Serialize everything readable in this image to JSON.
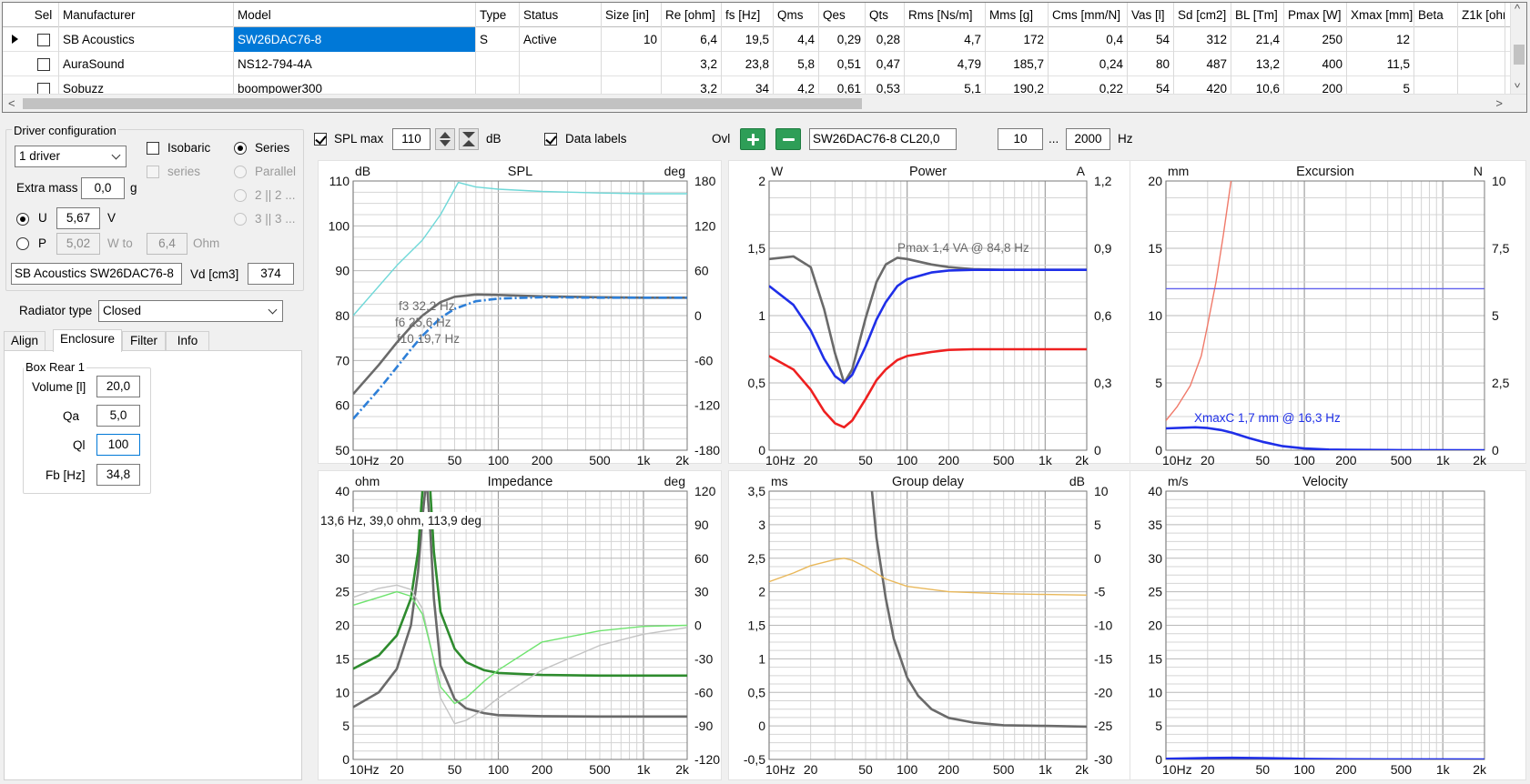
{
  "grid": {
    "columns": [
      "Sel",
      "Manufacturer",
      "Model",
      "Type",
      "Status",
      "Size [in]",
      "Re [ohm]",
      "fs [Hz]",
      "Qms",
      "Qes",
      "Qts",
      "Rms [Ns/m]",
      "Mms [g]",
      "Cms [mm/N]",
      "Vas [l]",
      "Sd [cm2]",
      "BL [Tm]",
      "Pmax [W]",
      "Xmax [mm]",
      "Beta",
      "Z1k [ohm"
    ],
    "rows": [
      {
        "sel": false,
        "cells": [
          "SB Acoustics",
          "SW26DAC76-8",
          "S",
          "Active",
          "10",
          "6,4",
          "19,5",
          "4,4",
          "0,29",
          "0,28",
          "4,7",
          "172",
          "0,4",
          "54",
          "312",
          "21,4",
          "250",
          "12",
          "",
          ""
        ]
      },
      {
        "sel": false,
        "cells": [
          "AuraSound",
          "NS12-794-4A",
          "",
          "",
          "",
          "3,2",
          "23,8",
          "5,8",
          "0,51",
          "0,47",
          "4,79",
          "185,7",
          "0,24",
          "80",
          "487",
          "13,2",
          "400",
          "11,5",
          "",
          ""
        ]
      },
      {
        "sel": false,
        "cells": [
          "Sobuzz",
          "boompower300",
          "",
          "",
          "",
          "3,2",
          "34",
          "4,2",
          "0,61",
          "0,53",
          "5,1",
          "190,2",
          "0,22",
          "54",
          "420",
          "10,6",
          "200",
          "5",
          "",
          ""
        ]
      }
    ]
  },
  "driver_config": {
    "title": "Driver configuration",
    "driver_count": "1 driver",
    "isobaric": "Isobaric",
    "isobaric_series": "series",
    "series": "Series",
    "parallel": "Parallel",
    "opt_2x2": "2 || 2 ...",
    "opt_3x3": "3 || 3 ...",
    "extra_mass_label": "Extra mass",
    "extra_mass": "0,0",
    "extra_mass_unit": "g",
    "u_label": "U",
    "u_value": "5,67",
    "u_unit": "V",
    "p_label": "P",
    "p_value": "5,02",
    "p_unit": "W to",
    "ohm_value": "6,4",
    "ohm_unit": "Ohm",
    "driver_name": "SB Acoustics SW26DAC76-8",
    "vd_label": "Vd [cm3]",
    "vd_value": "374"
  },
  "radiator": {
    "label": "Radiator type",
    "value": "Closed"
  },
  "tabs": [
    "Align",
    "Enclosure",
    "Filter",
    "Info"
  ],
  "box": {
    "title": "Box Rear 1",
    "volume_label": "Volume [l]",
    "volume": "20,0",
    "qa_label": "Qa",
    "qa": "5,0",
    "ql_label": "Ql",
    "ql": "100",
    "fb_label": "Fb [Hz]",
    "fb": "34,8"
  },
  "toolbar": {
    "spl_max_label": "SPL max",
    "spl_max": "110",
    "db_unit": "dB",
    "data_labels": "Data labels",
    "ovl_label": "Ovl",
    "overlay_name": "SW26DAC76-8 CL20,0",
    "f_from": "10",
    "ellipsis": "...",
    "f_to": "2000",
    "hz_unit": "Hz"
  },
  "colors": {
    "grid": "#d4d4d4",
    "grid_major": "#a0a0a0",
    "gray_curve": "#6a6a6a",
    "blue": "#1f2fe8",
    "red": "#ee2020",
    "cyan": "#6fd8d8",
    "green_dark": "#2e8b2e",
    "green_light": "#6fe36f",
    "orange": "#e9b85a",
    "salmon": "#f07a6a"
  },
  "chart_data": [
    {
      "type": "line",
      "title": "SPL",
      "unit_left": "dB",
      "unit_right": "deg",
      "x_scale": "log",
      "xlim": [
        10,
        2000
      ],
      "ylim": [
        50,
        110
      ],
      "y2lim": [
        -180,
        180
      ],
      "y_ticks": [
        "110",
        "100",
        "90",
        "80",
        "70",
        "60",
        "50"
      ],
      "y2_ticks": [
        "180",
        "120",
        "60",
        "0",
        "-60",
        "-120",
        "-180"
      ],
      "x_ticks": [
        "10Hz",
        "20",
        "50",
        "100",
        "200",
        "500",
        "1k",
        "2k"
      ],
      "annotations": [
        "f3 32,2 Hz",
        "f6 25,6 Hz",
        "f10 19,7 Hz"
      ],
      "series": [
        {
          "axis": "y",
          "color": "#6a6a6a",
          "x": [
            10,
            15,
            20,
            25,
            30,
            40,
            50,
            70,
            100,
            200,
            500,
            1000,
            2000
          ],
          "values": [
            62.5,
            69,
            74,
            77.5,
            80,
            83,
            84.2,
            84.7,
            84.6,
            84.3,
            84.1,
            84.0,
            84.0
          ]
        },
        {
          "axis": "y",
          "color": "#2d7fd8",
          "dash": true,
          "x": [
            10,
            15,
            20,
            25,
            30,
            40,
            50,
            70,
            100,
            200,
            500,
            1000,
            2000
          ],
          "values": [
            57,
            63.5,
            68.5,
            72.5,
            75.5,
            79.5,
            81.5,
            83.2,
            83.8,
            84.1,
            84.0,
            84.0,
            84.0
          ]
        },
        {
          "axis": "y2",
          "color": "#6fd8d8",
          "x": [
            10,
            20,
            30,
            40,
            53,
            70,
            100,
            200,
            500,
            1000,
            2000
          ],
          "values": [
            0,
            67,
            101,
            135,
            178,
            172,
            169,
            166,
            164,
            163,
            163
          ]
        }
      ]
    },
    {
      "type": "line",
      "title": "Power",
      "unit_left": "W",
      "unit_right": "A",
      "x_scale": "log",
      "xlim": [
        10,
        2000
      ],
      "ylim": [
        0,
        2
      ],
      "y2lim": [
        0,
        1.2
      ],
      "y_ticks": [
        "2",
        "1,5",
        "1",
        "0,5",
        "0"
      ],
      "y2_ticks": [
        "1,2",
        "0,9",
        "0,6",
        "0,3",
        "0"
      ],
      "x_ticks": [
        "10Hz",
        "20",
        "50",
        "100",
        "200",
        "500",
        "1k",
        "2k"
      ],
      "annotations": [
        "Pmax 1,4 VA  @ 84,8 Hz"
      ],
      "series": [
        {
          "axis": "y",
          "color": "#6a6a6a",
          "x": [
            10,
            15,
            20,
            25,
            30,
            35,
            40,
            50,
            60,
            70,
            85,
            100,
            150,
            200,
            300,
            500,
            1000,
            2000
          ],
          "values": [
            1.42,
            1.44,
            1.36,
            1.05,
            0.72,
            0.5,
            0.6,
            0.98,
            1.25,
            1.38,
            1.43,
            1.42,
            1.38,
            1.36,
            1.345,
            1.34,
            1.34,
            1.34
          ]
        },
        {
          "axis": "y",
          "color": "#1f2fe8",
          "x": [
            10,
            15,
            20,
            25,
            30,
            35,
            40,
            50,
            60,
            70,
            85,
            100,
            150,
            200,
            300,
            500,
            1000,
            2000
          ],
          "values": [
            1.22,
            1.08,
            0.89,
            0.68,
            0.55,
            0.5,
            0.56,
            0.77,
            0.97,
            1.1,
            1.22,
            1.27,
            1.32,
            1.335,
            1.34,
            1.34,
            1.34,
            1.34
          ]
        },
        {
          "axis": "y",
          "color": "#ee2020",
          "x": [
            10,
            15,
            20,
            25,
            30,
            35,
            40,
            50,
            60,
            70,
            85,
            100,
            150,
            200,
            300,
            500,
            1000,
            2000
          ],
          "values": [
            0.7,
            0.6,
            0.45,
            0.29,
            0.2,
            0.17,
            0.22,
            0.38,
            0.52,
            0.6,
            0.67,
            0.7,
            0.73,
            0.745,
            0.75,
            0.75,
            0.75,
            0.75
          ]
        }
      ]
    },
    {
      "type": "line",
      "title": "Excursion",
      "unit_left": "mm",
      "unit_right": "N",
      "x_scale": "log",
      "xlim": [
        10,
        2000
      ],
      "ylim": [
        0,
        20
      ],
      "y2lim": [
        0,
        10
      ],
      "y_ticks": [
        "20",
        "15",
        "10",
        "5",
        "0"
      ],
      "y2_ticks": [
        "10",
        "7,5",
        "5",
        "2,5",
        "0"
      ],
      "x_ticks": [
        "10Hz",
        "20",
        "50",
        "100",
        "200",
        "500",
        "1k",
        "2k"
      ],
      "annotations": [
        "XmaxC 1,7 mm  @ 16,3 Hz"
      ],
      "series": [
        {
          "axis": "y",
          "color": "#f07a6a",
          "x": [
            10,
            12,
            15,
            18,
            20,
            23,
            26,
            30
          ],
          "values": [
            2.2,
            3.2,
            4.8,
            7,
            9.3,
            12.5,
            16,
            20.5
          ]
        },
        {
          "axis": "y",
          "color": "#6060ee",
          "x": [
            10,
            2000
          ],
          "values": [
            12,
            12
          ]
        },
        {
          "axis": "y",
          "color": "#1f2fe8",
          "x": [
            10,
            16.3,
            20,
            25,
            30,
            40,
            50,
            70,
            100,
            150,
            200,
            500,
            2000
          ],
          "values": [
            1.62,
            1.7,
            1.65,
            1.5,
            1.3,
            0.9,
            0.62,
            0.3,
            0.13,
            0.05,
            0.03,
            0.01,
            0
          ]
        }
      ]
    },
    {
      "type": "line",
      "title": "Impedance",
      "unit_left": "ohm",
      "unit_right": "deg",
      "x_scale": "log",
      "xlim": [
        10,
        2000
      ],
      "ylim": [
        0,
        40
      ],
      "y2lim": [
        -120,
        120
      ],
      "y_ticks": [
        "40",
        "35",
        "30",
        "25",
        "20",
        "15",
        "10",
        "5",
        "0"
      ],
      "y2_ticks": [
        "120",
        "90",
        "60",
        "30",
        "0",
        "-30",
        "-60",
        "-90",
        "-120"
      ],
      "x_ticks": [
        "10Hz",
        "20",
        "50",
        "100",
        "200",
        "500",
        "1k",
        "2k"
      ],
      "annotations": [
        "13,6 Hz, 39,0 ohm, 113,9 deg"
      ],
      "series": [
        {
          "axis": "y",
          "color": "#6a6a6a",
          "x": [
            10,
            15,
            20,
            25,
            28,
            30,
            32,
            34,
            36,
            40,
            50,
            60,
            80,
            100,
            200,
            500,
            1000,
            2000
          ],
          "values": [
            7.8,
            10,
            13.5,
            20,
            28,
            36,
            42,
            34,
            24,
            14,
            9,
            7.6,
            6.9,
            6.6,
            6.45,
            6.4,
            6.4,
            6.4
          ]
        },
        {
          "axis": "y",
          "color": "#2e8b2e",
          "x": [
            10,
            15,
            20,
            25,
            28,
            30,
            32,
            34,
            36,
            40,
            50,
            60,
            80,
            100,
            200,
            500,
            1000,
            2000
          ],
          "values": [
            13.5,
            15.5,
            18.5,
            24,
            31,
            40,
            45,
            40,
            31,
            22,
            16.5,
            14.5,
            13.3,
            12.9,
            12.6,
            12.5,
            12.5,
            12.5
          ]
        },
        {
          "axis": "y2",
          "color": "#c4c4c4",
          "x": [
            10,
            15,
            20,
            25,
            30,
            35,
            40,
            50,
            60,
            80,
            100,
            200,
            500,
            1000,
            2000
          ],
          "values": [
            25,
            33,
            36,
            32,
            15,
            -25,
            -65,
            -88,
            -85,
            -75,
            -65,
            -40,
            -18,
            -8,
            -2
          ]
        },
        {
          "axis": "y2",
          "color": "#6fe36f",
          "x": [
            10,
            15,
            20,
            25,
            30,
            35,
            40,
            50,
            60,
            80,
            100,
            200,
            500,
            1000,
            2000
          ],
          "values": [
            18,
            25,
            30,
            26,
            10,
            -25,
            -55,
            -70,
            -65,
            -50,
            -40,
            -15,
            -5,
            -1,
            0
          ]
        }
      ]
    },
    {
      "type": "line",
      "title": "Group delay",
      "unit_left": "ms",
      "unit_right": "dB",
      "x_scale": "log",
      "xlim": [
        10,
        2000
      ],
      "ylim": [
        -0.5,
        3.5
      ],
      "y2lim": [
        -30,
        10
      ],
      "y_ticks": [
        "3,5",
        "3",
        "2,5",
        "2",
        "1,5",
        "1",
        "0,5",
        "0",
        "-0,5"
      ],
      "y2_ticks": [
        "10",
        "5",
        "0",
        "-5",
        "-10",
        "-15",
        "-20",
        "-25",
        "-30"
      ],
      "x_ticks": [
        "10Hz",
        "20",
        "50",
        "100",
        "200",
        "500",
        "1k",
        "2k"
      ],
      "annotations": [],
      "series": [
        {
          "axis": "y",
          "color": "#6a6a6a",
          "x": [
            55,
            60,
            70,
            80,
            100,
            120,
            150,
            200,
            300,
            500,
            1000,
            2000
          ],
          "values": [
            3.6,
            2.8,
            1.9,
            1.3,
            0.72,
            0.45,
            0.25,
            0.12,
            0.05,
            0.01,
            0.0,
            -0.01
          ]
        },
        {
          "axis": "y2",
          "color": "#e9b85a",
          "x": [
            10,
            15,
            20,
            30,
            35,
            40,
            50,
            70,
            100,
            200,
            500,
            1000,
            2000
          ],
          "values": [
            -3.5,
            -2.2,
            -1.1,
            -0.2,
            0,
            -0.3,
            -1.3,
            -3.1,
            -4.2,
            -5.0,
            -5.3,
            -5.4,
            -5.5
          ]
        }
      ]
    },
    {
      "type": "line",
      "title": "Velocity",
      "unit_left": "m/s",
      "unit_right": "",
      "x_scale": "log",
      "xlim": [
        10,
        2000
      ],
      "ylim": [
        0,
        40
      ],
      "y_ticks": [
        "40",
        "35",
        "30",
        "25",
        "20",
        "15",
        "10",
        "5",
        "0"
      ],
      "y2_ticks": [],
      "x_ticks": [
        "10Hz",
        "20",
        "50",
        "100",
        "200",
        "500",
        "1k",
        "2k"
      ],
      "annotations": [],
      "series": [
        {
          "axis": "y",
          "color": "#1f2fe8",
          "x": [
            10,
            20,
            30,
            50,
            80,
            100,
            200,
            500,
            2000
          ],
          "values": [
            0.1,
            0.22,
            0.25,
            0.2,
            0.12,
            0.08,
            0.03,
            0.01,
            0
          ]
        }
      ]
    }
  ]
}
